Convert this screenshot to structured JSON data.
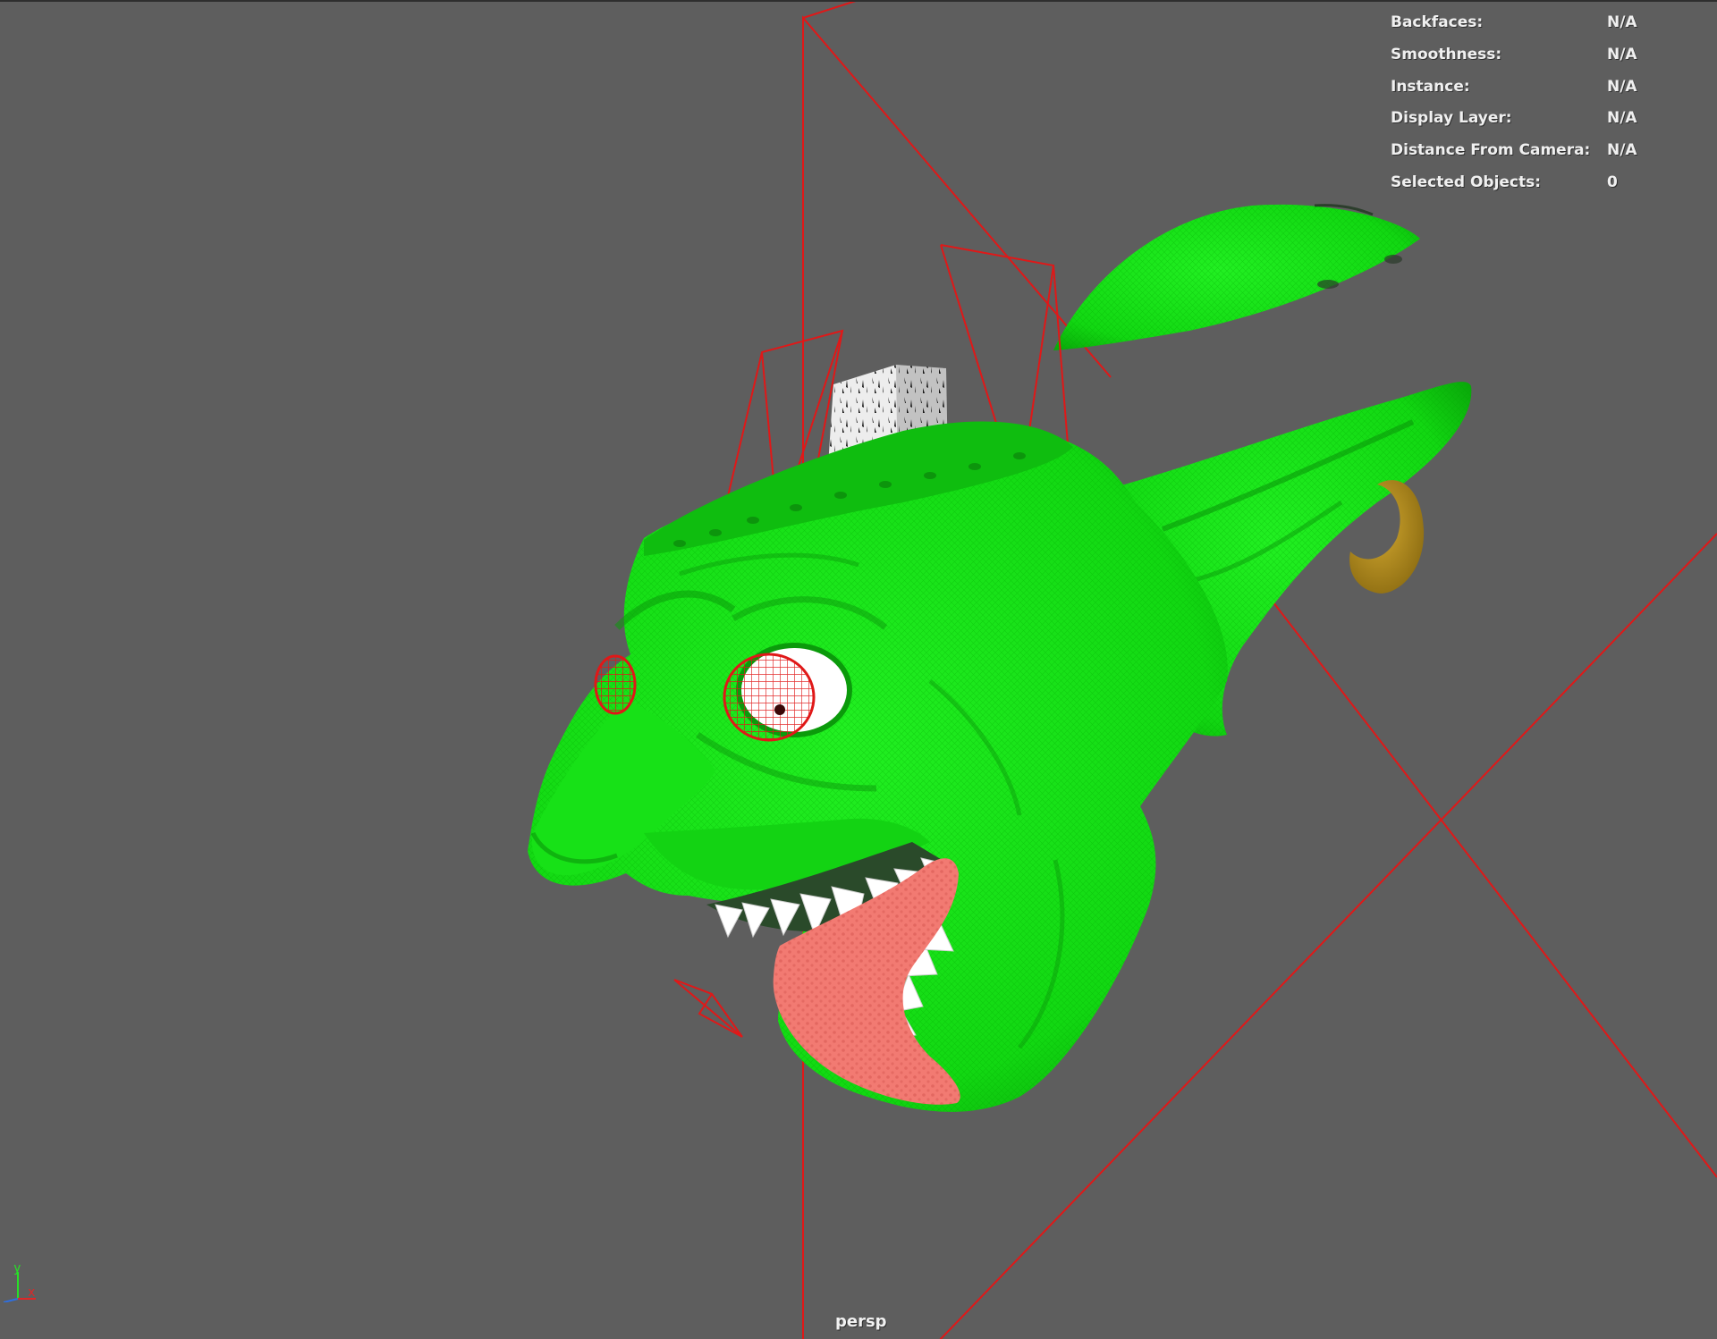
{
  "viewport": {
    "camera_name": "persp",
    "background_color": "#5e5e5e"
  },
  "hud": {
    "rows": [
      {
        "label": "Backfaces:",
        "value": "N/A"
      },
      {
        "label": "Smoothness:",
        "value": "N/A"
      },
      {
        "label": "Instance:",
        "value": "N/A"
      },
      {
        "label": "Display Layer:",
        "value": "N/A"
      },
      {
        "label": "Distance From Camera:",
        "value": "N/A"
      },
      {
        "label": "Selected Objects:",
        "value": "0"
      }
    ]
  },
  "axis_gizmo": {
    "y_label": "y",
    "x_label": "x"
  },
  "colors": {
    "goblin_skin": "#14e014",
    "tongue": "#f27a72",
    "earring": "#b8901a",
    "wireframe": "#e01818",
    "teeth": "#ffffff"
  }
}
